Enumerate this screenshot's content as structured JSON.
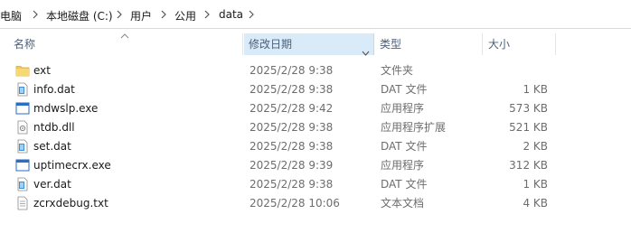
{
  "breadcrumb": [
    "电脑",
    "本地磁盘 (C:)",
    "用户",
    "公用",
    "data"
  ],
  "columns": {
    "name": "名称",
    "modified": "修改日期",
    "type": "类型",
    "size": "大小"
  },
  "files": [
    {
      "name": "ext",
      "modified": "2025/2/28 9:38",
      "type": "文件夹",
      "size": "",
      "icon": "folder-icon"
    },
    {
      "name": "info.dat",
      "modified": "2025/2/28 9:38",
      "type": "DAT 文件",
      "size": "1 KB",
      "icon": "dat-file-icon"
    },
    {
      "name": "mdwslp.exe",
      "modified": "2025/2/28 9:42",
      "type": "应用程序",
      "size": "573 KB",
      "icon": "exe-file-icon"
    },
    {
      "name": "ntdb.dll",
      "modified": "2025/2/28 9:38",
      "type": "应用程序扩展",
      "size": "521 KB",
      "icon": "dll-file-icon"
    },
    {
      "name": "set.dat",
      "modified": "2025/2/28 9:38",
      "type": "DAT 文件",
      "size": "2 KB",
      "icon": "dat-file-icon"
    },
    {
      "name": "uptimecrx.exe",
      "modified": "2025/2/28 9:39",
      "type": "应用程序",
      "size": "312 KB",
      "icon": "exe-file-icon"
    },
    {
      "name": "ver.dat",
      "modified": "2025/2/28 9:38",
      "type": "DAT 文件",
      "size": "1 KB",
      "icon": "dat-file-icon"
    },
    {
      "name": "zcrxdebug.txt",
      "modified": "2025/2/28 10:06",
      "type": "文本文档",
      "size": "4 KB",
      "icon": "text-file-icon"
    }
  ],
  "colors": {
    "header_selected_bg": "#d9ebf9",
    "folder_yellow": "#f4c84f",
    "exe_blue": "#2b6cc4"
  }
}
